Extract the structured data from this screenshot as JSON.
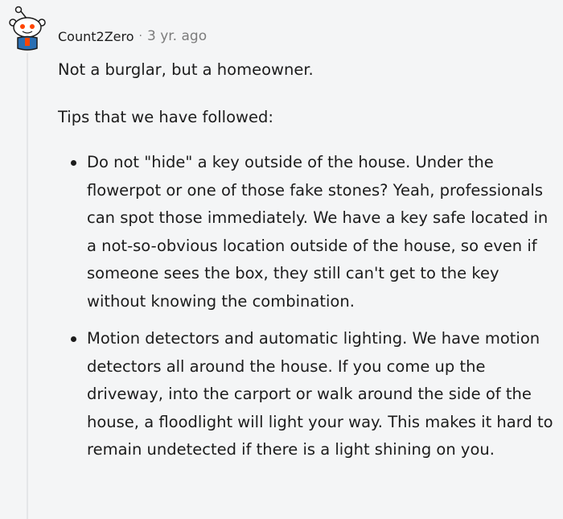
{
  "comment": {
    "author": "Count2Zero",
    "separator": "·",
    "age": "3 yr. ago",
    "intro": "Not a burglar, but a homeowner.",
    "tips_heading": "Tips that we have followed:",
    "tips": [
      {
        "text": "Do not \"hide\" a key outside of the house. Under the flowerpot or one of those fake stones? Yeah, professionals can spot those immediately. We have a key safe located in a not-so-obvious location outside of the house, so even if someone sees the box, they still can't get to the key without knowing the combination."
      },
      {
        "text": "Motion detectors and automatic lighting. We have motion detectors all around the house. If you come up the driveway, into the carport or walk around the side of the house, a floodlight will light your way. This makes it hard to remain undetected if there is a light shining on you."
      }
    ]
  },
  "colors": {
    "background": "#f4f5f6",
    "text": "#1c1c1c",
    "meta": "#7c7c7c",
    "avatar_accent": "#ff4500",
    "avatar_shirt": "#2a6fb3"
  },
  "icons": {
    "avatar": "snoo-avatar-icon"
  }
}
